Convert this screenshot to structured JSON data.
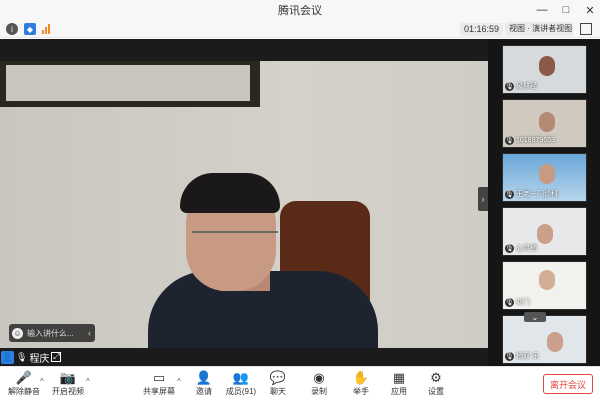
{
  "window": {
    "title": "腾讯会议",
    "controls": [
      "—",
      "□",
      "✕"
    ]
  },
  "infobar": {
    "timer": "01:16:59",
    "view_label": "视图 · 演讲者视图",
    "icons": [
      "info-icon",
      "shield-icon",
      "signal-icon",
      "fullscreen-icon"
    ],
    "accent": "#2f7de1"
  },
  "main": {
    "chat_chip": {
      "text": "输入讲什么...",
      "arrow": "‹"
    },
    "speaker": {
      "name": "程庆"
    },
    "collapse_glyph": "›"
  },
  "participants": [
    {
      "label": "风林径",
      "bg": "#d6dadc"
    },
    {
      "label": "1018879653",
      "bg": "#cfc9bf"
    },
    {
      "label": "王老一门诊科",
      "bg": "#6aa7d8"
    },
    {
      "label": "心灵栖",
      "bg": "#e6e8ea"
    },
    {
      "label": "刘门",
      "bg": "#f1f1ee"
    },
    {
      "label": "杨双 乐",
      "bg": "#e0e6ea"
    }
  ],
  "toolbar": {
    "items": [
      {
        "name": "mute-button",
        "glyph": "🎤",
        "label": "解除静音"
      },
      {
        "name": "video-button",
        "glyph": "📷",
        "label": "开启视频"
      },
      {
        "name": "share-screen-button",
        "glyph": "▭",
        "label": "共享屏幕"
      },
      {
        "name": "invite-button",
        "glyph": "👤",
        "label": "邀请"
      },
      {
        "name": "members-button",
        "glyph": "👥",
        "label": "成员(91)"
      },
      {
        "name": "chat-button",
        "glyph": "💬",
        "label": "聊天"
      },
      {
        "name": "record-button",
        "glyph": "◉",
        "label": "录制"
      },
      {
        "name": "raise-hand-button",
        "glyph": "✋",
        "label": "举手"
      },
      {
        "name": "apps-button",
        "glyph": "▦",
        "label": "应用"
      },
      {
        "name": "settings-button",
        "glyph": "⚙",
        "label": "设置"
      }
    ],
    "leave_label": "离开会议",
    "leave_color": "#e0473f"
  }
}
